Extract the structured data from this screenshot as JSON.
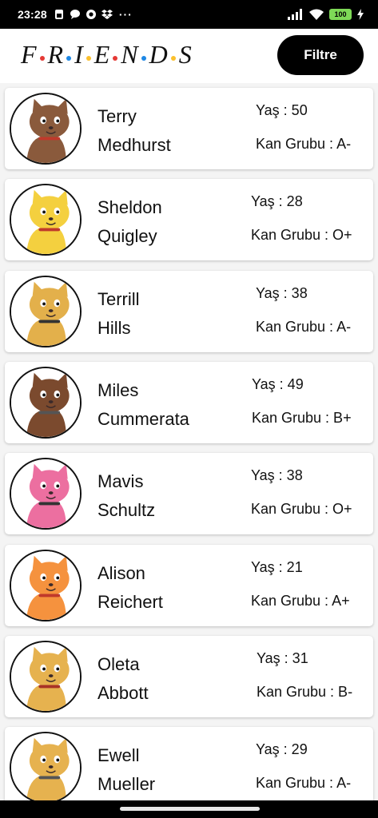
{
  "status_bar": {
    "time": "23:28",
    "dots": "···",
    "battery": "100",
    "icons": [
      "sim-icon",
      "chat-icon",
      "camera-icon",
      "dropbox-icon",
      "signal-icon",
      "wifi-icon",
      "battery-icon",
      "charging-icon"
    ]
  },
  "header": {
    "logo_letters": [
      "F",
      "R",
      "I",
      "E",
      "N",
      "D",
      "S"
    ],
    "logo_dot_colors": [
      "#e53935",
      "#1e88e5",
      "#fbc02d",
      "#e53935",
      "#1e88e5",
      "#fbc02d"
    ],
    "filter_label": "Filtre"
  },
  "people": [
    {
      "first": "Terry",
      "last": "Medhurst",
      "age": "Yaş : 50",
      "blood": "Kan Grubu : A-",
      "fur": "#8a5a3c",
      "accent": "#c0392b"
    },
    {
      "first": "Sheldon",
      "last": "Quigley",
      "age": "Yaş : 28",
      "blood": "Kan Grubu : O+",
      "fur": "#f4d03f",
      "accent": "#c0392b"
    },
    {
      "first": "Terrill",
      "last": "Hills",
      "age": "Yaş : 38",
      "blood": "Kan Grubu : A-",
      "fur": "#e3b04b",
      "accent": "#333333"
    },
    {
      "first": "Miles",
      "last": "Cummerata",
      "age": "Yaş : 49",
      "blood": "Kan Grubu : B+",
      "fur": "#7b4a2e",
      "accent": "#555555"
    },
    {
      "first": "Mavis",
      "last": "Schultz",
      "age": "Yaş : 38",
      "blood": "Kan Grubu : O+",
      "fur": "#ec6fa0",
      "accent": "#333333"
    },
    {
      "first": "Alison",
      "last": "Reichert",
      "age": "Yaş : 21",
      "blood": "Kan Grubu : A+",
      "fur": "#f5923e",
      "accent": "#c0392b"
    },
    {
      "first": "Oleta",
      "last": "Abbott",
      "age": "Yaş : 31",
      "blood": "Kan Grubu : B-",
      "fur": "#e6b24f",
      "accent": "#a93226"
    },
    {
      "first": "Ewell",
      "last": "Mueller",
      "age": "Yaş : 29",
      "blood": "Kan Grubu : A-",
      "fur": "#e6b24f",
      "accent": "#555555"
    }
  ]
}
